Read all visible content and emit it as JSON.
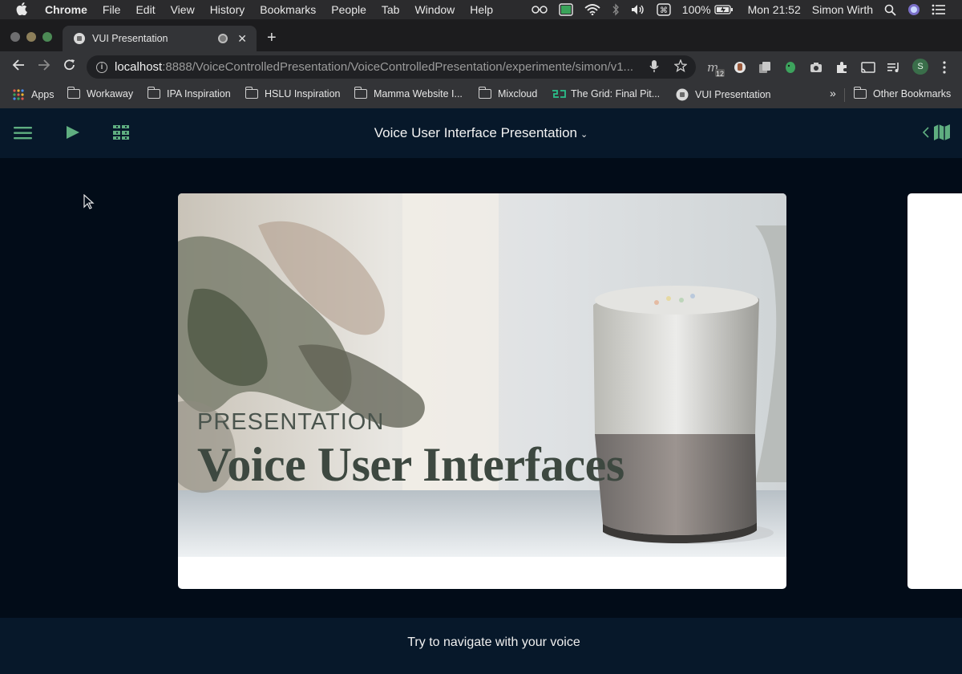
{
  "menubar": {
    "app": "Chrome",
    "items": [
      "File",
      "Edit",
      "View",
      "History",
      "Bookmarks",
      "People",
      "Tab",
      "Window",
      "Help"
    ],
    "battery": "100%",
    "clock": "Mon 21:52",
    "user": "Simon Wirth"
  },
  "tab": {
    "title": "VUI Presentation",
    "close_label": "✕",
    "new_tab_label": "+"
  },
  "toolbar": {
    "url_host": "localhost",
    "url_path": ":8888/VoiceControlledPresentation/VoiceControlledPresentation/experimente/simon/v1...",
    "extension_badge": "12",
    "profile_initial": "S"
  },
  "bookmarks": {
    "apps_label": "Apps",
    "items": [
      "Workaway",
      "IPA Inspiration",
      "HSLU Inspiration",
      "Mamma Website I...",
      "Mixcloud",
      "The Grid: Final Pit...",
      "VUI Presentation"
    ],
    "overflow_label": "»",
    "other_label": "Other Bookmarks"
  },
  "app": {
    "title": "Voice User Interface Presentation",
    "title_chevron": "⌄"
  },
  "slide": {
    "kicker": "PRESENTATION",
    "headline": "Voice User Interfaces"
  },
  "footer": {
    "hint": "Try to navigate with your voice"
  },
  "colors": {
    "app_background": "#020c18",
    "header_background": "#07182a",
    "accent_green": "#5fae80"
  },
  "icons": [
    "apple-icon",
    "hamburger-menu-icon",
    "play-icon",
    "grid-icon",
    "map-icon",
    "mic-icon",
    "star-icon"
  ]
}
